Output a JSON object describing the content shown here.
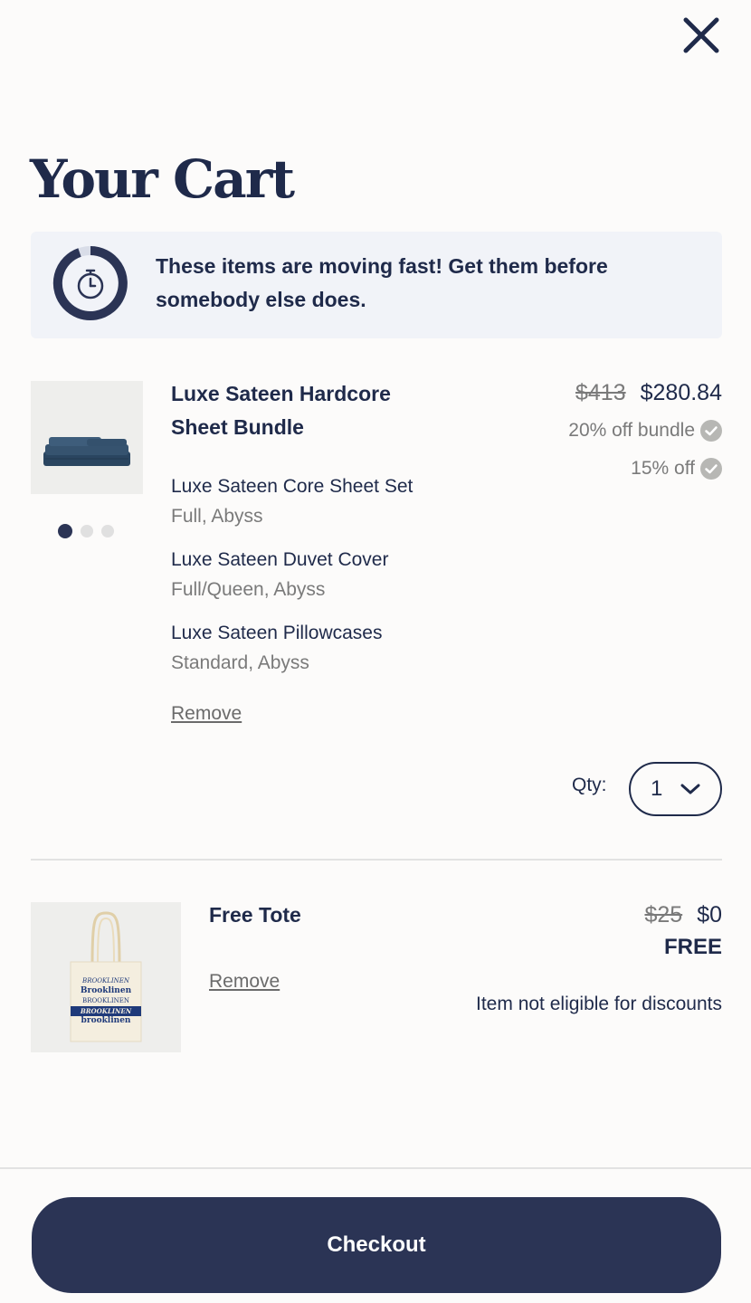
{
  "header": {
    "title": "Your Cart",
    "close_icon": "close-icon"
  },
  "banner": {
    "text": "These items are moving fast! Get them before somebody else does.",
    "icon": "stopwatch-icon"
  },
  "items": [
    {
      "name": "Luxe Sateen Hardcore Sheet Bundle",
      "price_original": "$413",
      "price_current": "$280.84",
      "discounts": [
        "20% off bundle",
        "15% off"
      ],
      "components": [
        {
          "name": "Luxe Sateen Core Sheet Set",
          "variant": "Full, Abyss"
        },
        {
          "name": "Luxe Sateen Duvet Cover",
          "variant": "Full/Queen, Abyss"
        },
        {
          "name": "Luxe Sateen Pillowcases",
          "variant": "Standard, Abyss"
        }
      ],
      "remove_label": "Remove",
      "qty_label": "Qty:",
      "qty_value": "1",
      "image_dots": 3,
      "active_dot": 0
    },
    {
      "name": "Free Tote",
      "price_original": "$25",
      "price_current": "$0",
      "free_label": "FREE",
      "note": "Item not eligible for discounts",
      "remove_label": "Remove",
      "tote_brand_lines": [
        "BROOKLINEN",
        "Brooklinen",
        "BROOKLINEN",
        "BROOKLINEN",
        "brooklinen"
      ]
    }
  ],
  "footer": {
    "checkout_label": "Checkout"
  },
  "colors": {
    "navy": "#2b3455",
    "text": "#1f2a4a",
    "muted": "#7a7a7a",
    "banner_bg": "#f1f3f8",
    "check": "#b7b7b4"
  }
}
